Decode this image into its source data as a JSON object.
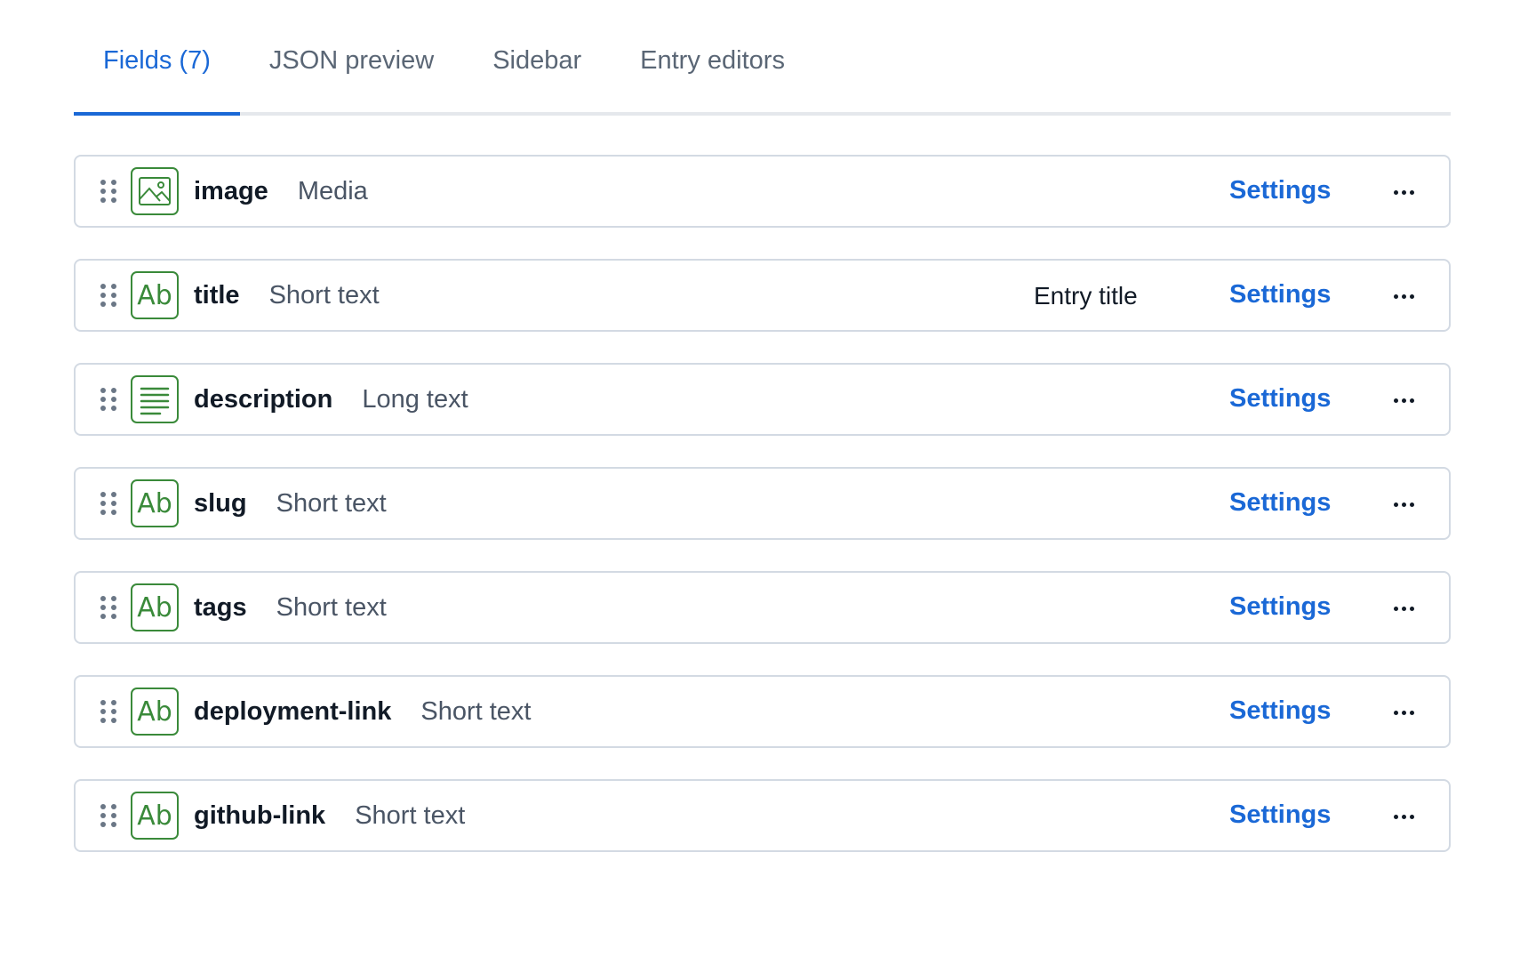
{
  "tabs": [
    {
      "label": "Fields (7)",
      "active": true
    },
    {
      "label": "JSON preview",
      "active": false
    },
    {
      "label": "Sidebar",
      "active": false
    },
    {
      "label": "Entry editors",
      "active": false
    }
  ],
  "colors": {
    "accent": "#1a68d6",
    "icon_green": "#3a8a3a",
    "border": "#d3dae3"
  },
  "fields": [
    {
      "name": "image",
      "type": "Media",
      "icon": "media-icon",
      "entry_title": "",
      "settings_label": "Settings"
    },
    {
      "name": "title",
      "type": "Short text",
      "icon": "short-text-icon",
      "entry_title": "Entry title",
      "settings_label": "Settings"
    },
    {
      "name": "description",
      "type": "Long text",
      "icon": "long-text-icon",
      "entry_title": "",
      "settings_label": "Settings"
    },
    {
      "name": "slug",
      "type": "Short text",
      "icon": "short-text-icon",
      "entry_title": "",
      "settings_label": "Settings"
    },
    {
      "name": "tags",
      "type": "Short text",
      "icon": "short-text-icon",
      "entry_title": "",
      "settings_label": "Settings"
    },
    {
      "name": "deployment-link",
      "type": "Short text",
      "icon": "short-text-icon",
      "entry_title": "",
      "settings_label": "Settings"
    },
    {
      "name": "github-link",
      "type": "Short text",
      "icon": "short-text-icon",
      "entry_title": "",
      "settings_label": "Settings"
    }
  ],
  "icon_glyphs": {
    "short_text": "Ab"
  }
}
